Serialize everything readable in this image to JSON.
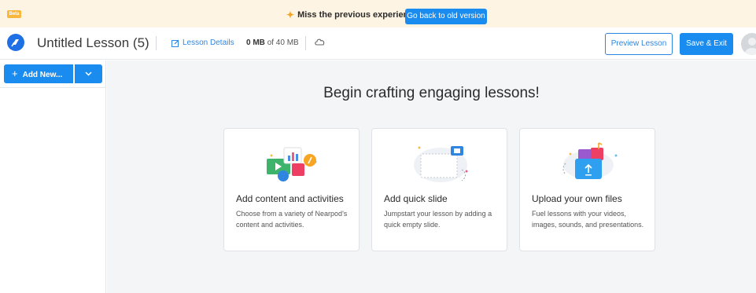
{
  "banner": {
    "badge": "Beta",
    "message": "Miss the previous experience?",
    "old_version_button": "Go back to old version"
  },
  "header": {
    "lesson_title": "Untitled Lesson (5)",
    "lesson_details": "Lesson Details",
    "storage_used": "0 MB",
    "storage_total": "of 40 MB",
    "preview_button": "Preview Lesson",
    "save_button": "Save & Exit"
  },
  "sidebar": {
    "add_new_button": "Add New..."
  },
  "main": {
    "headline": "Begin crafting engaging lessons!",
    "cards": [
      {
        "title": "Add content and activities",
        "description": "Choose from a variety of Nearpod's content and activities."
      },
      {
        "title": "Add quick slide",
        "description": "Jumpstart your lesson by adding a quick empty slide."
      },
      {
        "title": "Upload your own files",
        "description": "Fuel lessons with your videos, images, sounds, and presentations."
      }
    ]
  },
  "colors": {
    "accent": "#1a8cf0",
    "banner_bg": "#fdf4e3",
    "main_bg": "#f4f5f7"
  },
  "icons": [
    "nearpod-logo-icon",
    "sparkle-icon",
    "edit-icon",
    "cloud-icon",
    "plus-icon",
    "chevron-down-icon",
    "avatar-icon"
  ]
}
